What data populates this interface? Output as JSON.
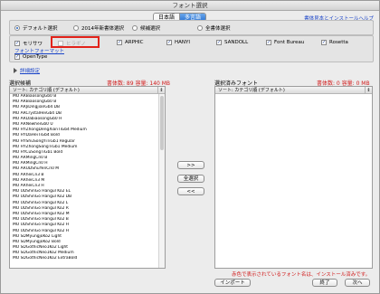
{
  "window": {
    "title": "フォント選択"
  },
  "lang_tabs": [
    {
      "label": "日本語"
    },
    {
      "label": "多言語"
    }
  ],
  "help_link": "書体見本とインストールヘルプ",
  "sets": [
    {
      "label": "デフォルト選択",
      "selected": true
    },
    {
      "label": "2014年新書体選択",
      "selected": false
    },
    {
      "label": "候補選択",
      "selected": false
    },
    {
      "label": "全書体選択",
      "selected": false
    }
  ],
  "vendors": [
    {
      "label": "モリサワ",
      "checked": true,
      "disabled": false
    },
    {
      "label": "ヒラギノ",
      "checked": false,
      "disabled": true
    },
    {
      "label": "ARPHIC",
      "checked": true,
      "disabled": false
    },
    {
      "label": "HANYI",
      "checked": true,
      "disabled": false
    },
    {
      "label": "SANDOLL",
      "checked": true,
      "disabled": false
    },
    {
      "label": "Font Bureau",
      "checked": true,
      "disabled": false
    },
    {
      "label": "Rosetta",
      "checked": true,
      "disabled": false
    }
  ],
  "font_format_link": "フォントフォーマット",
  "opentype": {
    "label": "OpenType",
    "checked": true
  },
  "detail_settings": "詳細設定",
  "left_panel": {
    "title": "選択候補",
    "summary": "書体数: 89 容量: 140 MB",
    "sort_label": "ソート: カテゴリ順 (デフォルト)",
    "items": [
      "MO ARBiaosongGb0 B",
      "MO ARBiaosongGb0 B",
      "MO ARJiDingjianGb4 DB",
      "MO ARCrystalHeiGb4 DB",
      "MO ARDabiaosongGb0 H",
      "MO ARNewheiGb0 U",
      "MO HYZhongDengXianTiGb4 Medium",
      "MO HYDaHeiTiGb4 Bold",
      "MO HYShuSongYiTiGb1 Regular",
      "MO HYZhongSongTiGb1 Medium",
      "MO HYCuSongTiGb1 Bold",
      "MO ARMingCn0 B",
      "MO ARMingCn0 H",
      "MO ARUDShuYenCn0 M",
      "MO ARheiCn3 B",
      "MO ARheiCn3 M",
      "MO ARheiCn3 H",
      "MO UDShinGo Hangul Ko2 EL",
      "MO UDShinGo Hangul Ko2 DB",
      "MO UDShinGo Hangul Ko2 L",
      "MO UDShinGo Hangul Ko2 R",
      "MO UDShinGo Hangul Ko2 M",
      "MO UDShinGo Hangul Ko2 B",
      "MO UDShinGo Hangul Ko2 H",
      "MO UDShinGo Hangul Ko2 H",
      "MO SDMyungjoKo2 Light",
      "MO SDMyungjoKo2 Bold",
      "MO SDGothicNeo1Ko2 Light",
      "MO SDGothicNeo1Ko2 Medium",
      "MO SDGothicNeo1Ko2 ExtraBold"
    ]
  },
  "transfer_buttons": [
    ">>",
    "全選択",
    "<<"
  ],
  "right_panel": {
    "title": "選択済みフォント",
    "summary": "書体数: 0 容量: 0 MB",
    "sort_label": "ソート: カテゴリ順 (デフォルト)"
  },
  "notice": "赤色で表示されているフォント名は、インストール済みです。",
  "buttons": {
    "import": "インポート",
    "close": "終了",
    "next": "次へ"
  },
  "colors": {
    "accent": "#2f78d6",
    "highlight_red": "#e2231a",
    "link": "#1a44c8"
  }
}
